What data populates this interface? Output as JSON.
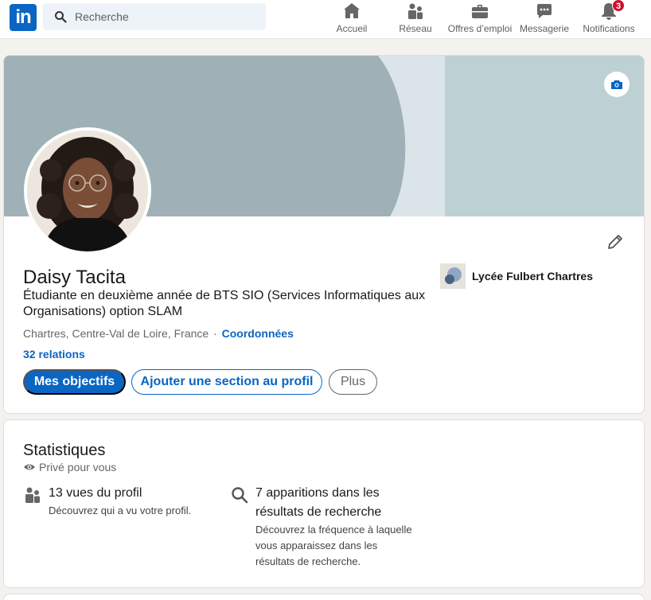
{
  "nav": {
    "logo_text": "in",
    "search_placeholder": "Recherche",
    "items": [
      {
        "label": "Accueil",
        "icon": "home-icon"
      },
      {
        "label": "Réseau",
        "icon": "network-icon"
      },
      {
        "label": "Offres d’emploi",
        "icon": "briefcase-icon"
      },
      {
        "label": "Messagerie",
        "icon": "messaging-icon"
      },
      {
        "label": "Notifications",
        "icon": "bell-icon",
        "badge": "3"
      }
    ]
  },
  "profile": {
    "name": "Daisy Tacita",
    "headline": "Étudiante en deuxième année de BTS SIO (Services Informatiques aux Organisations) option SLAM",
    "location": "Chartres, Centre-Val de Loire, France",
    "separator": "·",
    "contact_link": "Coordonnées",
    "relations": "32 relations",
    "organization": "Lycée Fulbert Chartres",
    "buttons": {
      "primary": "Mes objectifs",
      "secondary": "Ajouter une section au profil",
      "more": "Plus"
    }
  },
  "stats": {
    "title": "Statistiques",
    "private_label": "Privé pour vous",
    "items": [
      {
        "title": "13 vues du profil",
        "description": "Découvrez qui a vu votre profil.",
        "icon": "people-icon"
      },
      {
        "title": "7 apparitions dans les résultats de recherche",
        "description": "Découvrez la fréquence à laquelle vous apparaissez dans les résultats de recherche.",
        "icon": "search-icon"
      }
    ]
  },
  "colors": {
    "brand": "#0a66c2",
    "badge": "#cb112d",
    "banner_dark": "#9fb1b6",
    "banner_light": "#bdd1d5",
    "page_bg": "#f4f2ee"
  }
}
